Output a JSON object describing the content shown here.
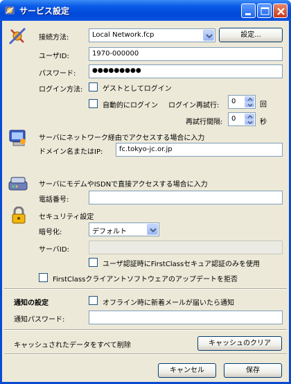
{
  "window": {
    "title": "サービス設定"
  },
  "connection": {
    "method_label": "接続方法:",
    "method_value": "Local Network.fcp",
    "settings_button": "設定..."
  },
  "user": {
    "id_label": "ユーザID:",
    "id_value": "1970-000000"
  },
  "password": {
    "label": "パスワード:",
    "value": "●●●●●●●●●"
  },
  "login": {
    "method_label": "ログイン方法:",
    "guest_label": "ゲストとしてログイン",
    "auto_label": "自動的にログイン",
    "retry_label": "ログイン再試行:",
    "retry_value": "0",
    "retry_unit": "回",
    "interval_label": "再試行間隔:",
    "interval_value": "0",
    "interval_unit": "秒"
  },
  "network": {
    "header": "サーバにネットワーク経由でアクセスする場合に入力",
    "domain_label": "ドメイン名またはIP:",
    "domain_value": "fc.tokyo-jc.or.jp"
  },
  "modem": {
    "header": "サーバにモデムやISDNで直接アクセスする場合に入力",
    "phone_label": "電話番号:",
    "phone_value": ""
  },
  "security": {
    "header": "セキュリティ設定",
    "encryption_label": "暗号化:",
    "encryption_value": "デフォルト",
    "server_id_label": "サーバID:",
    "server_id_value": "",
    "firstclass_auth_label": "ユーザ認証時にFirstClassセキュア認証のみを使用",
    "reject_update_label": "FirstClassクライアントソフトウェアのアップデートを拒否"
  },
  "notify": {
    "header": "通知の設定",
    "offline_label": "オフライン時に新着メールが届いたら通知",
    "password_label": "通知パスワード:",
    "password_value": ""
  },
  "cache": {
    "label": "キャッシュされたデータをすべて削除",
    "clear_button": "キャッシュのクリア"
  },
  "footer": {
    "cancel_button": "キャンセル",
    "save_button": "保存"
  },
  "colors": {
    "titlebar": "#0a5ae8",
    "dialog": "#ece9d8",
    "close": "#c8391a"
  }
}
